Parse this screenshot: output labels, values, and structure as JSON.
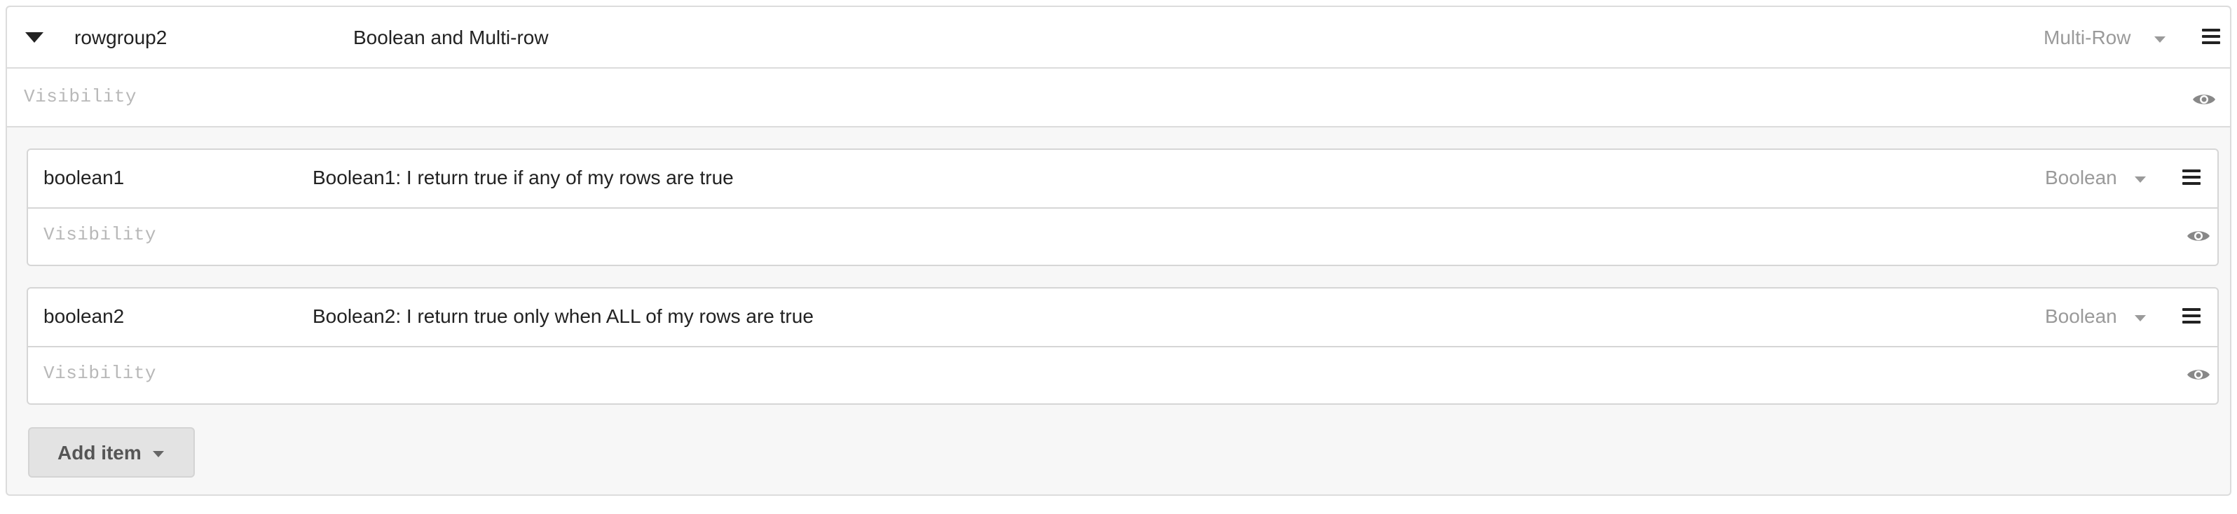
{
  "group": {
    "name": "rowgroup2",
    "label": "Boolean and Multi-row",
    "type": "Multi-Row",
    "visibility_placeholder": "Visibility"
  },
  "items": [
    {
      "name": "boolean1",
      "label": "Boolean1: I return true if any of my rows are true",
      "type": "Boolean",
      "visibility_placeholder": "Visibility"
    },
    {
      "name": "boolean2",
      "label": "Boolean2: I return true only when ALL of my rows are true",
      "type": "Boolean",
      "visibility_placeholder": "Visibility"
    }
  ],
  "add_button": {
    "label": "Add item"
  },
  "icons": {
    "collapse": "caret-down-icon",
    "dropdown": "chevron-down-icon",
    "menu": "hamburger-menu-icon",
    "visibility": "eye-icon"
  }
}
